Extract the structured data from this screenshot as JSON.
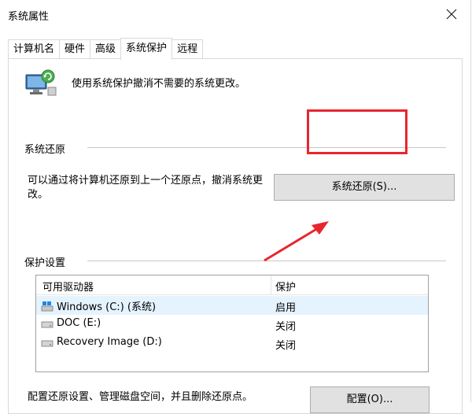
{
  "window": {
    "title": "系统属性"
  },
  "tabs": [
    {
      "label": "计算机名",
      "active": false
    },
    {
      "label": "硬件",
      "active": false
    },
    {
      "label": "高级",
      "active": false
    },
    {
      "label": "系统保护",
      "active": true
    },
    {
      "label": "远程",
      "active": false
    }
  ],
  "intro": {
    "text": "使用系统保护撤消不需要的系统更改。",
    "icon": "system-protection-icon"
  },
  "restore_section": {
    "heading": "系统还原",
    "description": "可以通过将计算机还原到上一个还原点，撤消系统更改。",
    "button_label": "系统还原(S)..."
  },
  "protection_section": {
    "heading": "保护设置",
    "columns": [
      "可用驱动器",
      "保护"
    ],
    "drives": [
      {
        "name": "Windows (C:) (系统)",
        "status": "启用",
        "icon": "windows-drive-icon",
        "selected": true
      },
      {
        "name": "DOC (E:)",
        "status": "关闭",
        "icon": "drive-icon",
        "selected": false
      },
      {
        "name": "Recovery Image (D:)",
        "status": "关闭",
        "icon": "drive-icon",
        "selected": false
      }
    ],
    "config_description": "配置还原设置、管理磁盘空间，并且删除还原点。",
    "config_button_label": "配置(O)..."
  },
  "colors": {
    "annotation": "#e8262d",
    "selected_row": "#e5f3ff",
    "button_bg": "#e1e1e1"
  }
}
